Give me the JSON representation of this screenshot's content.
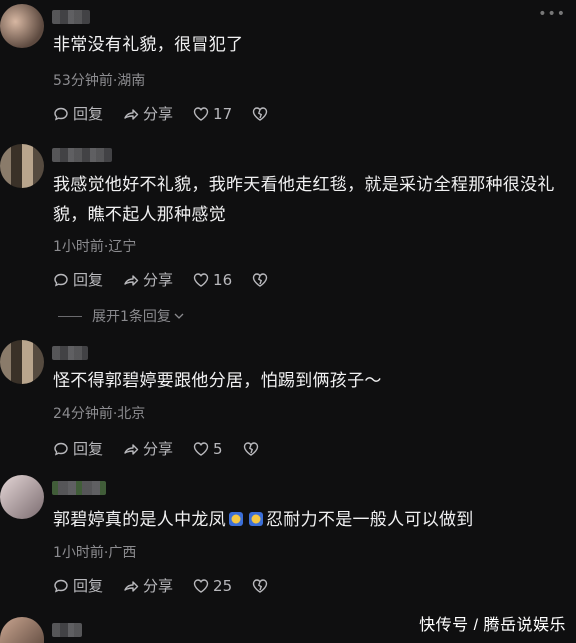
{
  "comments": [
    {
      "text": "非常没有礼貌，很冒犯了",
      "meta": "53分钟前·湖南",
      "reply": "回复",
      "share": "分享",
      "likes": "17"
    },
    {
      "text": "我感觉他好不礼貌，我昨天看他走红毯，就是采访全程那种很没礼貌，瞧不起人那种感觉",
      "meta": "1小时前·辽宁",
      "reply": "回复",
      "share": "分享",
      "likes": "16",
      "expand": "展开1条回复"
    },
    {
      "text": "怪不得郭碧婷要跟他分居，怕踢到俩孩子～",
      "meta": "24分钟前·北京",
      "reply": "回复",
      "share": "分享",
      "likes": "5"
    },
    {
      "text_a": "郭碧婷真的是人中龙凤",
      "text_b": "忍耐力不是一般人可以做到",
      "meta": "1小时前·广西",
      "reply": "回复",
      "share": "分享",
      "likes": "25"
    }
  ],
  "top_dots": "•••",
  "watermark": "快传号 / 腾岳说娱乐",
  "icons": [
    "reply-icon",
    "share-icon",
    "like-heart-icon",
    "dislike-heart-icon",
    "chevron-down-icon",
    "emoji-icon"
  ]
}
